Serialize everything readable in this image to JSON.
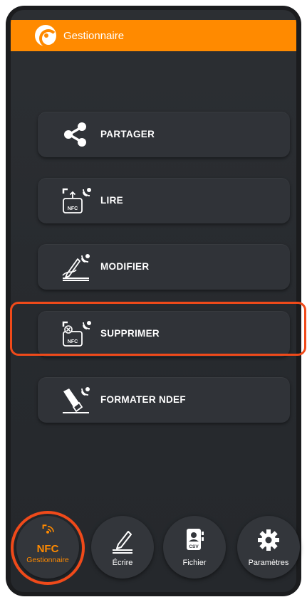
{
  "app": {
    "title": "Gestionnaire",
    "accent_color": "#ff8a00",
    "highlight_color": "#f04a1a"
  },
  "menu": {
    "items": [
      {
        "label": "PARTAGER",
        "icon": "share-icon"
      },
      {
        "label": "LIRE",
        "icon": "nfc-read-icon"
      },
      {
        "label": "MODIFIER",
        "icon": "edit-pen-icon"
      },
      {
        "label": "SUPPRIMER",
        "icon": "nfc-delete-icon",
        "highlighted": true
      },
      {
        "label": "FORMATER NDEF",
        "icon": "format-eraser-icon"
      }
    ],
    "nfc_badge": "NFC"
  },
  "bottom_nav": {
    "items": [
      {
        "label": "Gestionnaire",
        "sublabel": "NFC",
        "icon": "nfc-wireless-icon",
        "active": true
      },
      {
        "label": "Écrire",
        "icon": "pen-write-icon"
      },
      {
        "label": "Fichier",
        "icon": "csv-file-icon",
        "badge": "CSV"
      },
      {
        "label": "Paramètres",
        "icon": "gear-icon"
      }
    ]
  }
}
